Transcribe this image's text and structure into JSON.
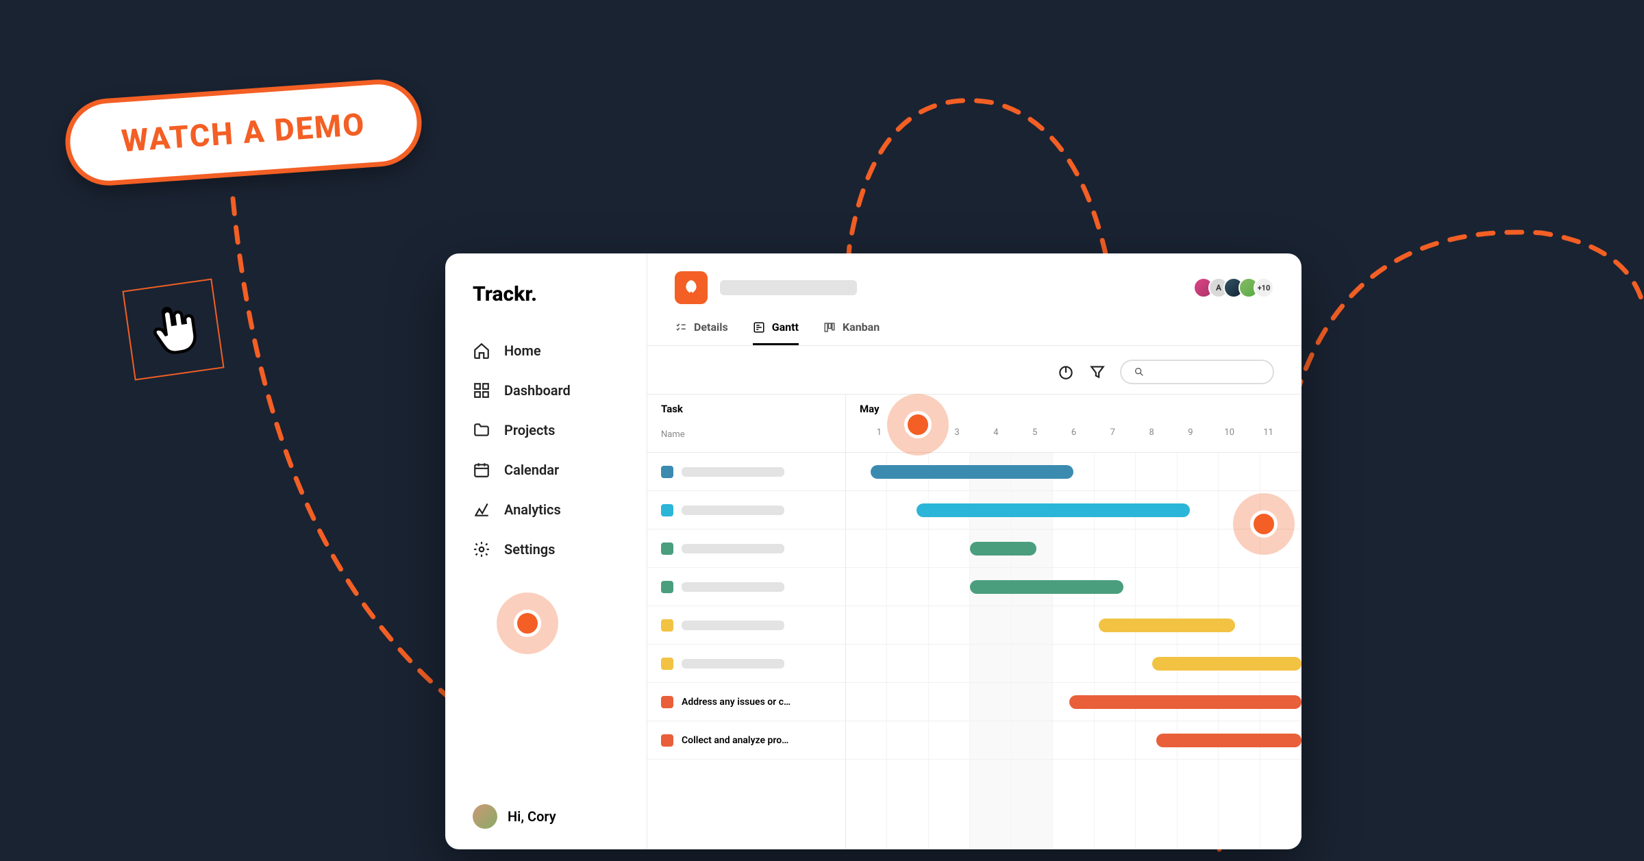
{
  "demo_button": "WATCH A DEMO",
  "app_name": "Trackr.",
  "sidebar": {
    "items": [
      {
        "label": "Home"
      },
      {
        "label": "Dashboard"
      },
      {
        "label": "Projects"
      },
      {
        "label": "Calendar"
      },
      {
        "label": "Analytics"
      },
      {
        "label": "Settings"
      }
    ]
  },
  "user": {
    "greeting": "Hi, Cory"
  },
  "avatars": {
    "letter": "A",
    "overflow": "+10"
  },
  "tabs": [
    {
      "label": "Details"
    },
    {
      "label": "Gantt"
    },
    {
      "label": "Kanban"
    }
  ],
  "gantt": {
    "task_header": "Task",
    "task_subheader": "Name",
    "month": "May",
    "days": [
      "1",
      "2",
      "3",
      "4",
      "5",
      "6",
      "7",
      "8",
      "9",
      "10",
      "11"
    ],
    "tasks": [
      {
        "label": "",
        "color": "#3b8bb0",
        "start": 1.6,
        "end": 6.5
      },
      {
        "label": "",
        "color": "#2bb5d8",
        "start": 2.7,
        "end": 9.3
      },
      {
        "label": "",
        "color": "#4a9e7e",
        "start": 4.0,
        "end": 5.6
      },
      {
        "label": "",
        "color": "#4a9e7e",
        "start": 4.0,
        "end": 7.7
      },
      {
        "label": "",
        "color": "#f2c243",
        "start": 7.1,
        "end": 10.4
      },
      {
        "label": "",
        "color": "#f2c243",
        "start": 8.4,
        "end": 12.0
      },
      {
        "label": "Address any issues or c…",
        "color": "#e85f3a",
        "start": 6.4,
        "end": 12.0
      },
      {
        "label": "Collect and analyze pro…",
        "color": "#e85f3a",
        "start": 8.5,
        "end": 12.0
      }
    ]
  }
}
